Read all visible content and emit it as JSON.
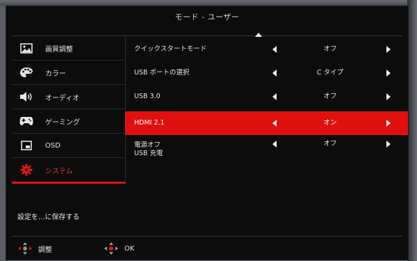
{
  "title": "モード - ユーザー",
  "sidebar": {
    "items": [
      {
        "label": "画質調整",
        "icon": "picture-icon",
        "active": false
      },
      {
        "label": "カラー",
        "icon": "palette-icon",
        "active": false
      },
      {
        "label": "オーディオ",
        "icon": "speaker-icon",
        "active": false
      },
      {
        "label": "ゲーミング",
        "icon": "gamepad-icon",
        "active": false
      },
      {
        "label": "OSD",
        "icon": "osd-icon",
        "active": false
      },
      {
        "label": "システム",
        "icon": "gear-icon",
        "active": true
      }
    ]
  },
  "settings": [
    {
      "label": "クイックスタートモード",
      "value": "オフ"
    },
    {
      "label": "USB ポートの選択",
      "value": "C タイプ"
    },
    {
      "label": "USB 3.0",
      "value": "オフ"
    },
    {
      "label": "HDMI 2.1",
      "value": "オン",
      "highlighted": true
    },
    {
      "label_line1": "電源オフ",
      "label_line2": "USB 充電",
      "value": "オフ"
    }
  ],
  "save_label": "設定を...に保存する",
  "footer": {
    "adjust_label": "調整",
    "ok_label": "OK"
  },
  "colors": {
    "accent": "#e01010",
    "background": "#0c0c0d",
    "text": "#e6e6e6"
  }
}
